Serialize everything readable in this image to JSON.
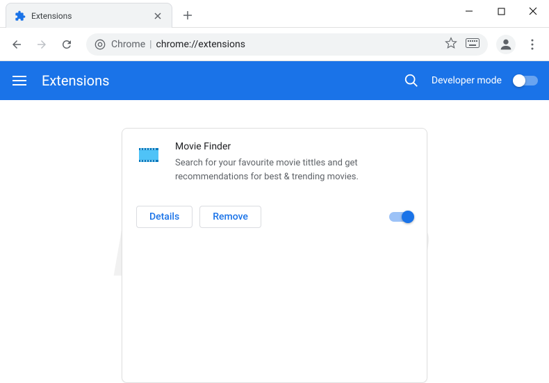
{
  "window": {
    "tab_title": "Extensions"
  },
  "omnibox": {
    "prefix": "Chrome",
    "url": "chrome://extensions"
  },
  "header": {
    "title": "Extensions",
    "dev_mode_label": "Developer mode"
  },
  "extension": {
    "name": "Movie Finder",
    "description": "Search for your favourite movie tittles and get recommendations for best & trending movies.",
    "details_label": "Details",
    "remove_label": "Remove",
    "enabled": true
  },
  "icons": {
    "tab": "puzzle-icon",
    "back": "arrow-left-icon",
    "forward": "arrow-right-icon",
    "reload": "reload-icon",
    "chrome": "chrome-icon",
    "star": "star-icon",
    "keyboard": "keyboard-icon",
    "user": "user-icon",
    "menu": "dots-vertical-icon",
    "hamburger": "hamburger-icon",
    "search": "search-icon",
    "close": "close-icon",
    "plus": "plus-icon",
    "minimize": "minimize-icon",
    "maximize": "maximize-icon",
    "window_close": "close-icon",
    "film": "film-icon"
  },
  "colors": {
    "primary": "#1a73e8",
    "text": "#202124",
    "muted": "#5f6368"
  },
  "watermark": "pcrisk.com"
}
